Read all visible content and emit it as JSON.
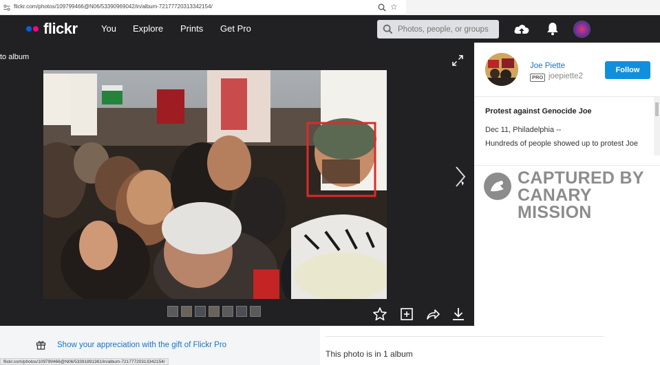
{
  "browser": {
    "url": "flickr.com/photos/109799466@N06/53390969042/in/album-72177720313342154/",
    "status_url": "flickr.com/photos/109799466@N06/53391891361/in/album-72177720313342154/"
  },
  "header": {
    "logo": "flickr",
    "nav": [
      "You",
      "Explore",
      "Prints",
      "Get Pro"
    ],
    "search_placeholder": "Photos, people, or groups"
  },
  "stage": {
    "back_label": "to album"
  },
  "owner": {
    "name": "Joe Piette",
    "pro_badge": "PRO",
    "username": "joepiette2",
    "follow_label": "Follow"
  },
  "photo": {
    "title": "Protest against Genocide Joe",
    "description_line1": "Dec 11, Philadelphia --",
    "description_line2": "Hundreds of people showed up to protest Joe"
  },
  "watermark": {
    "line1": "CAPTURED BY",
    "line2": "CANARY MISSION"
  },
  "footer": {
    "gift_text": "Show your appreciation with the gift of Flickr Pro",
    "album_count": "This photo is in 1 album"
  },
  "colors": {
    "header_bg": "#212124",
    "link": "#1b72c5",
    "follow_bg": "#128fdc",
    "highlight_box": "#e0282a"
  }
}
